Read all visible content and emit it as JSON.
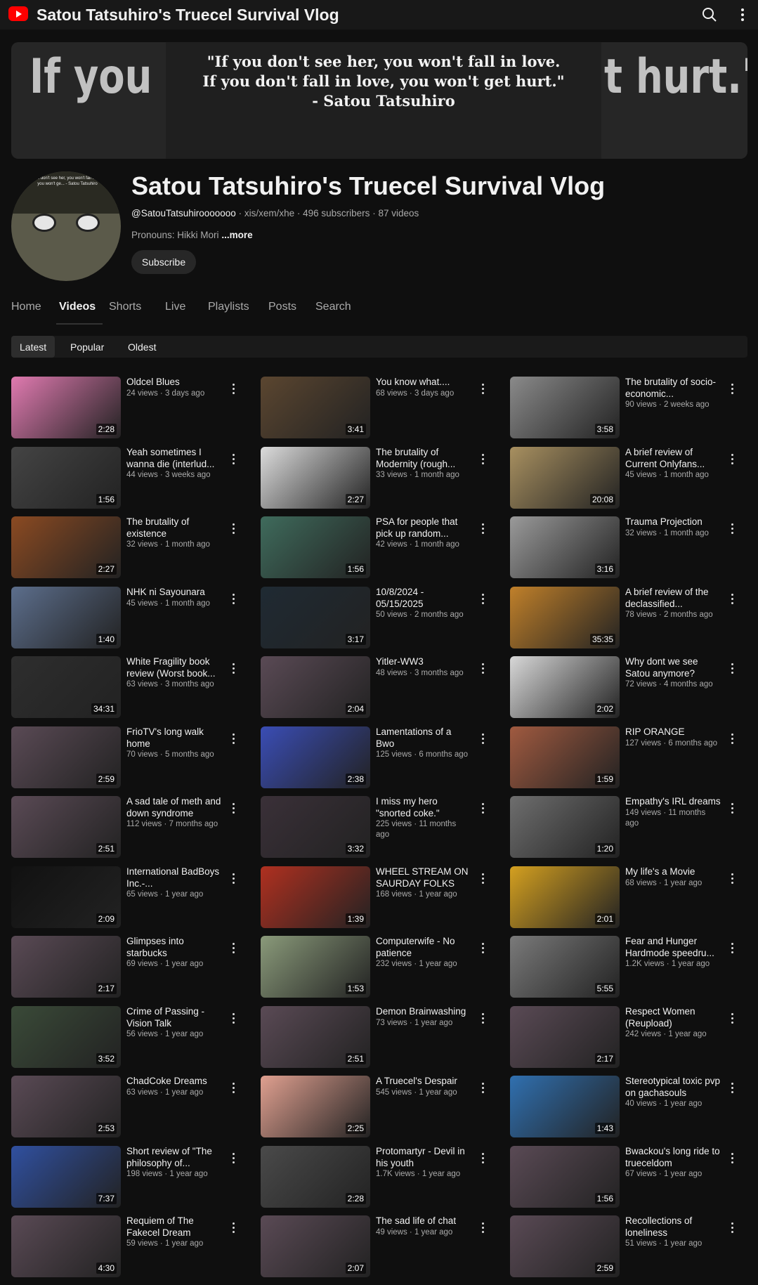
{
  "app": {
    "window_title": "Satou Tatsuhiro's Truecel Survival Vlog"
  },
  "banner": {
    "big_left": "If you dc",
    "big_right": "t hurt.\"",
    "quote": "\"If you don't see her, you won't fall in love.\nIf you don't fall in love, you won't get hurt.\"\n- Satou Tatsuhiro"
  },
  "channel": {
    "name": "Satou Tatsuhiro's Truecel Survival Vlog",
    "handle": "@SatouTatsuhirooooooo",
    "pronouns_inline": "xis/xem/xhe",
    "subscribers": "496 subscribers",
    "video_count": "87 videos",
    "description": "Pronouns: Hikki Mori",
    "more_label": "...more",
    "subscribe_label": "Subscribe",
    "avatar_text": "If you don't see her, you won't fall in love, you won't ge... - Satou Tatsuhiro"
  },
  "tabs": [
    "Home",
    "Videos",
    "Shorts",
    "Live",
    "Playlists",
    "Posts",
    "Search"
  ],
  "active_tab": "Videos",
  "filters": [
    "Latest",
    "Popular",
    "Oldest"
  ],
  "active_filter": "Latest",
  "videos": [
    {
      "title": "Oldcel Blues",
      "views": "24 views",
      "age": "3 days ago",
      "duration": "2:28",
      "thumb_color": "#e07ab0"
    },
    {
      "title": "You know what....",
      "views": "68 views",
      "age": "3 days ago",
      "duration": "3:41",
      "thumb_color": "#5b4630"
    },
    {
      "title": "The brutality of socio-economic...",
      "views": "90 views",
      "age": "2 weeks ago",
      "duration": "3:58",
      "thumb_color": "#8a8a8a"
    },
    {
      "title": "Yeah sometimes I wanna die (interlud...",
      "views": "44 views",
      "age": "3 weeks ago",
      "duration": "1:56",
      "thumb_color": "#444444"
    },
    {
      "title": "The brutality of Modernity (rough...",
      "views": "33 views",
      "age": "1 month ago",
      "duration": "2:27",
      "thumb_color": "#dcdcdc"
    },
    {
      "title": "A brief review of Current Onlyfans...",
      "views": "45 views",
      "age": "1 month ago",
      "duration": "20:08",
      "thumb_color": "#a89060"
    },
    {
      "title": "The brutality of existence",
      "views": "32 views",
      "age": "1 month ago",
      "duration": "2:27",
      "thumb_color": "#8b4a22"
    },
    {
      "title": "PSA for people that pick up random...",
      "views": "42 views",
      "age": "1 month ago",
      "duration": "1:56",
      "thumb_color": "#3f6b5c"
    },
    {
      "title": "Trauma Projection",
      "views": "32 views",
      "age": "1 month ago",
      "duration": "3:16",
      "thumb_color": "#9a9a9a"
    },
    {
      "title": "NHK ni Sayounara",
      "views": "45 views",
      "age": "1 month ago",
      "duration": "1:40",
      "thumb_color": "#5c6e8c"
    },
    {
      "title": "10/8/2024 - 05/15/2025",
      "views": "50 views",
      "age": "2 months ago",
      "duration": "3:17",
      "thumb_color": "#1f2a33"
    },
    {
      "title": "A brief review of the declassified...",
      "views": "78 views",
      "age": "2 months ago",
      "duration": "35:35",
      "thumb_color": "#c0802a"
    },
    {
      "title": "White Fragility book review (Worst book...",
      "views": "63 views",
      "age": "3 months ago",
      "duration": "34:31",
      "thumb_color": "#2e2e2e"
    },
    {
      "title": "Yitler-WW3",
      "views": "48 views",
      "age": "3 months ago",
      "duration": "2:04",
      "thumb_color": "#5a4a55"
    },
    {
      "title": "Why dont we see Satou anymore?",
      "views": "72 views",
      "age": "4 months ago",
      "duration": "2:02",
      "thumb_color": "#d8d8d8"
    },
    {
      "title": "FrioTV's long walk home",
      "views": "70 views",
      "age": "5 months ago",
      "duration": "2:59",
      "thumb_color": "#5a4a55"
    },
    {
      "title": "Lamentations of a Bwo",
      "views": "125 views",
      "age": "6 months ago",
      "duration": "2:38",
      "thumb_color": "#3a4db5"
    },
    {
      "title": "RIP ORANGE",
      "views": "127 views",
      "age": "6 months ago",
      "duration": "1:59",
      "thumb_color": "#a05a40"
    },
    {
      "title": "A sad tale of meth and down syndrome",
      "views": "112 views",
      "age": "7 months ago",
      "duration": "2:51",
      "thumb_color": "#5a4a55"
    },
    {
      "title": "I miss my hero \"snorted coke.\"",
      "views": "225 views",
      "age": "11 months ago",
      "duration": "3:32",
      "thumb_color": "#3a3038"
    },
    {
      "title": "Empathy's IRL dreams",
      "views": "149 views",
      "age": "11 months ago",
      "duration": "1:20",
      "thumb_color": "#6e6e6e"
    },
    {
      "title": "International BadBoys Inc.-...",
      "views": "65 views",
      "age": "1 year ago",
      "duration": "2:09",
      "thumb_color": "#111111"
    },
    {
      "title": "WHEEL STREAM ON SAURDAY FOLKS",
      "views": "168 views",
      "age": "1 year ago",
      "duration": "1:39",
      "thumb_color": "#b03020"
    },
    {
      "title": "My life's a Movie",
      "views": "68 views",
      "age": "1 year ago",
      "duration": "2:01",
      "thumb_color": "#d4a020"
    },
    {
      "title": "Glimpses into starbucks",
      "views": "69 views",
      "age": "1 year ago",
      "duration": "2:17",
      "thumb_color": "#5a4a55"
    },
    {
      "title": "Computerwife - No patience",
      "views": "232 views",
      "age": "1 year ago",
      "duration": "1:53",
      "thumb_color": "#8a9a7a"
    },
    {
      "title": "Fear and Hunger Hardmode speedru...",
      "views": "1.2K views",
      "age": "1 year ago",
      "duration": "5:55",
      "thumb_color": "#7a7a7a"
    },
    {
      "title": "Crime of Passing - Vision Talk",
      "views": "56 views",
      "age": "1 year ago",
      "duration": "3:52",
      "thumb_color": "#3a4a38"
    },
    {
      "title": "Demon Brainwashing",
      "views": "73 views",
      "age": "1 year ago",
      "duration": "2:51",
      "thumb_color": "#5a4a55"
    },
    {
      "title": "Respect Women (Reupload)",
      "views": "242 views",
      "age": "1 year ago",
      "duration": "2:17",
      "thumb_color": "#5a4a55"
    },
    {
      "title": "ChadCoke Dreams",
      "views": "63 views",
      "age": "1 year ago",
      "duration": "2:53",
      "thumb_color": "#5a4a55"
    },
    {
      "title": "A Truecel's Despair",
      "views": "545 views",
      "age": "1 year ago",
      "duration": "2:25",
      "thumb_color": "#e0a090"
    },
    {
      "title": "Stereotypical toxic pvp on gachasouls",
      "views": "40 views",
      "age": "1 year ago",
      "duration": "1:43",
      "thumb_color": "#3070b0"
    },
    {
      "title": "Short review of \"The philosophy of...",
      "views": "198 views",
      "age": "1 year ago",
      "duration": "7:37",
      "thumb_color": "#3050a0"
    },
    {
      "title": "Protomartyr - Devil in his youth",
      "views": "1.7K views",
      "age": "1 year ago",
      "duration": "2:28",
      "thumb_color": "#4a4a4a"
    },
    {
      "title": "Bwackou's long ride to trueceldom",
      "views": "67 views",
      "age": "1 year ago",
      "duration": "1:56",
      "thumb_color": "#5a4a55"
    },
    {
      "title": "Requiem of The Fakecel Dream",
      "views": "59 views",
      "age": "1 year ago",
      "duration": "4:30",
      "thumb_color": "#5a4a55"
    },
    {
      "title": "The sad life of chat",
      "views": "49 views",
      "age": "1 year ago",
      "duration": "2:07",
      "thumb_color": "#5a4a55"
    },
    {
      "title": "Recollections of loneliness",
      "views": "51 views",
      "age": "1 year ago",
      "duration": "2:59",
      "thumb_color": "#5a4a55"
    }
  ]
}
